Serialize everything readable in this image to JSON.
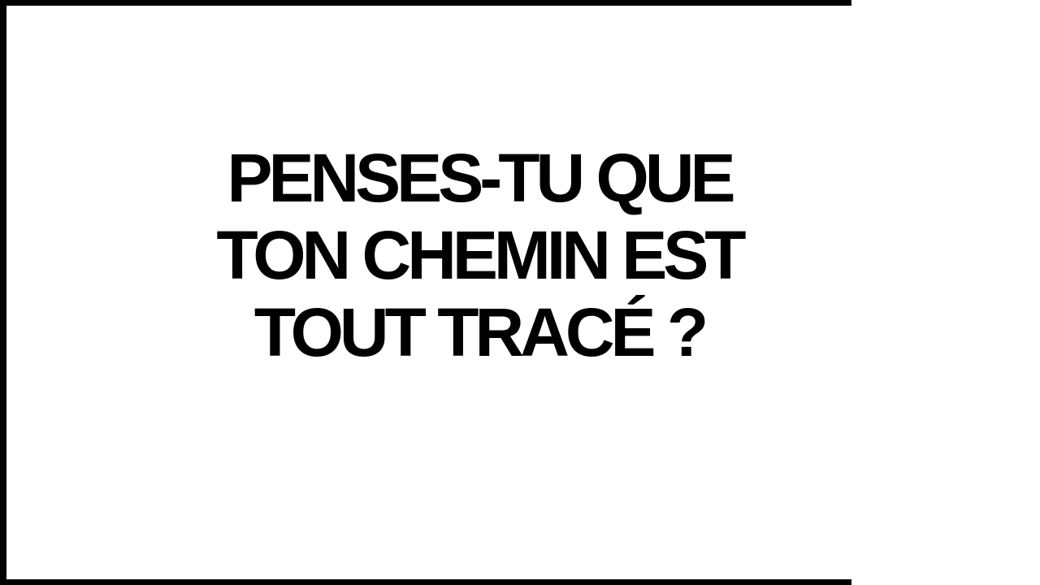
{
  "slide": {
    "lines": [
      "PENSES-TU QUE",
      "TON CHEMIN EST",
      "TOUT TRACÉ ?"
    ]
  },
  "colors": {
    "background": "#ffffff",
    "frame": "#000000",
    "text": "#000000"
  }
}
